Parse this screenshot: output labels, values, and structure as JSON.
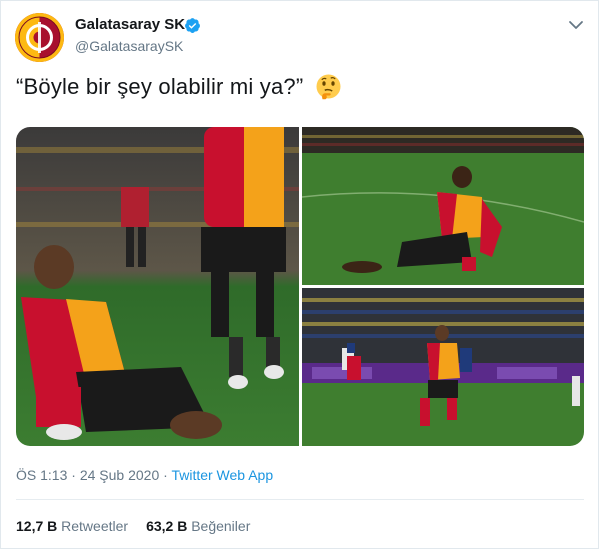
{
  "account": {
    "name": "Galatasaray SK",
    "handle": "@GalatasaraySK",
    "verified": true,
    "avatar_icon": "galatasaray-crest-icon",
    "brand_colors": {
      "red": "#a8102e",
      "yellow": "#fdb912"
    }
  },
  "menu": {
    "icon": "chevron-down-icon"
  },
  "tweet": {
    "text": "“Böyle bir şey olabilir mi ya?”",
    "emoji": "thinking-face-icon"
  },
  "media": {
    "photos": [
      {
        "icon": "photo-player-knee-slide-celebration"
      },
      {
        "icon": "photo-player-knee-slide-pitch"
      },
      {
        "icon": "photo-player-running-stadium"
      }
    ]
  },
  "meta": {
    "time": "ÖS 1:13",
    "separator": " · ",
    "date": "24 Şub 2020",
    "source": "Twitter Web App"
  },
  "stats": {
    "retweets_count": "12,7 B",
    "retweets_label": "Retweetler",
    "likes_count": "63,2 B",
    "likes_label": "Beğeniler"
  },
  "colors": {
    "link": "#1b95e0",
    "secondary_text": "#657786",
    "verified_blue": "#1da1f2"
  }
}
